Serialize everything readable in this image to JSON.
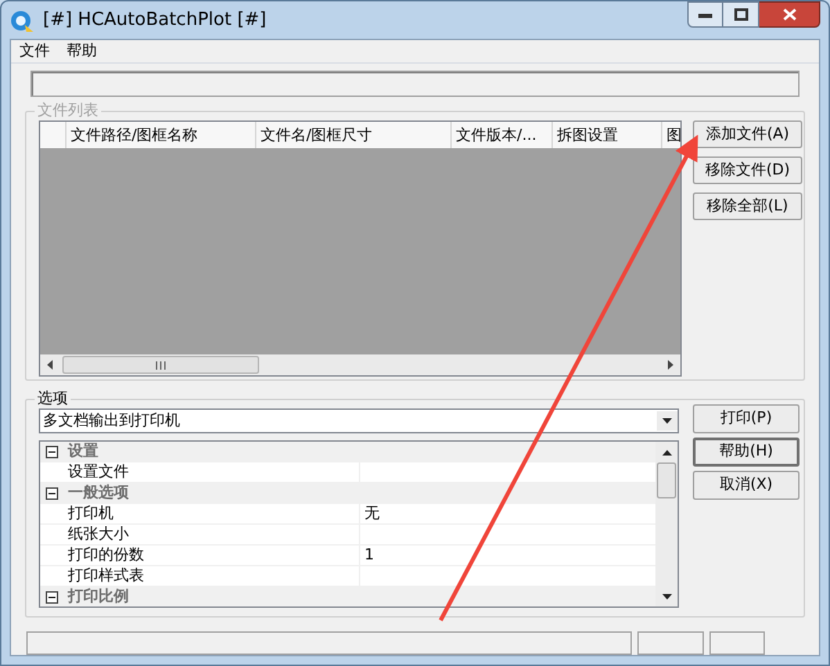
{
  "window": {
    "title": "[#] HCAutoBatchPlot [#]"
  },
  "menu": [
    "文件",
    "帮助"
  ],
  "file_list": {
    "title": "文件列表",
    "columns": [
      "文件路径/图框名称",
      "文件名/图框尺寸",
      "文件版本/...",
      "拆图设置",
      "图"
    ],
    "buttons": [
      "添加文件(A)",
      "移除文件(D)",
      "移除全部(L)"
    ]
  },
  "options": {
    "title": "选项",
    "mode": "多文档输出到打印机",
    "rows": [
      {
        "kind": "category",
        "name": "设置",
        "expanded": true
      },
      {
        "kind": "item",
        "name": "设置文件",
        "value": ""
      },
      {
        "kind": "category",
        "name": "一般选项",
        "expanded": true
      },
      {
        "kind": "item",
        "name": "打印机",
        "value": "无"
      },
      {
        "kind": "item",
        "name": "纸张大小",
        "value": ""
      },
      {
        "kind": "item",
        "name": "打印的份数",
        "value": "1"
      },
      {
        "kind": "item",
        "name": "打印样式表",
        "value": ""
      },
      {
        "kind": "category",
        "name": "打印比例",
        "expanded": true
      }
    ],
    "buttons": [
      {
        "label": "打印(P)",
        "selected": false
      },
      {
        "label": "帮助(H)",
        "selected": true
      },
      {
        "label": "取消(X)",
        "selected": false
      }
    ]
  }
}
